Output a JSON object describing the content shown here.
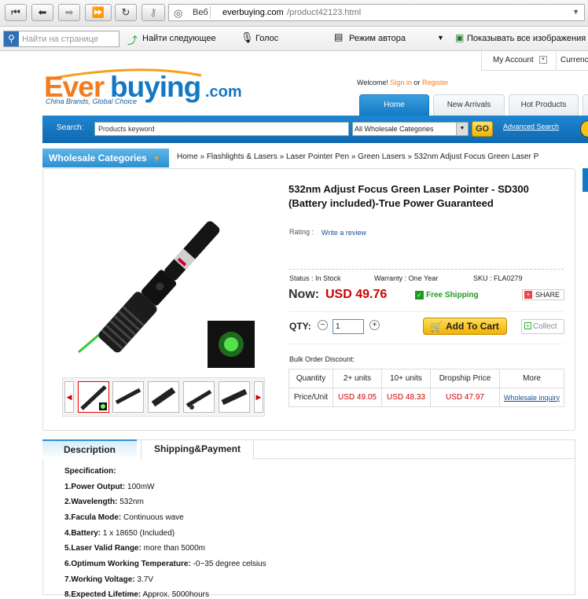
{
  "browser": {
    "address": "everbuying.com/product42123.html",
    "address_domain": "everbuying.com",
    "address_path": "/product42123.html",
    "site_chip": "Веб",
    "find_placeholder": "Найти на странице",
    "find_next": "Найти следующее",
    "voice": "Голос",
    "author_mode": "Режим автора",
    "show_images": "Показывать все изображения"
  },
  "header": {
    "my_account": "My Account",
    "currency": "Currenc",
    "logo_text": "Everbuying.com",
    "tagline": "China Brands, Global Choice",
    "welcome": "Welcome!",
    "sign_in": "Sign in",
    "or": "or",
    "register": "Register",
    "tabs": [
      "Home",
      "New Arrivals",
      "Hot Products"
    ]
  },
  "search": {
    "label": "Search:",
    "placeholder": "Products keyword",
    "category": "All Wholesale Categories",
    "go": "GO",
    "advanced": "Advanced Search"
  },
  "categories_button": "Wholesale Categories",
  "breadcrumb": [
    "Home",
    "Flashlights & Lasers",
    "Laser Pointer Pen",
    "Green Lasers",
    "532nm Adjust Focus Green Laser P"
  ],
  "product": {
    "title_line1": "532nm Adjust Focus Green Laser Pointer - SD300",
    "title_line2": "(Battery included)-True Power Guaranteed",
    "rating_label": "Rating :",
    "write_review": "Write a review",
    "status": "Status : In Stock",
    "warranty": "Warranty : One Year",
    "sku": "SKU : FLA0279",
    "now_label": "Now:",
    "price": "USD 49.76",
    "free_shipping": "Free Shipping",
    "share": "SHARE",
    "qty_label": "QTY:",
    "qty_value": "1",
    "add_to_cart": "Add To Cart",
    "collect": "Collect",
    "bulk_label": "Bulk Order Discount:",
    "bulk_headers": [
      "Quantity",
      "2+ units",
      "10+ units",
      "Dropship Price",
      "More"
    ],
    "bulk_row": [
      "Price/Unit",
      "USD 49.05",
      "USD 48.33",
      "USD 47.97",
      "Wholesale inquiry"
    ]
  },
  "tabs2": [
    "Description",
    "Shipping&Payment"
  ],
  "spec": {
    "heading": "Specification:",
    "items": [
      {
        "k": "1.Power Output:",
        "v": "100mW"
      },
      {
        "k": "2.Wavelength:",
        "v": "532nm"
      },
      {
        "k": "3.Facula Mode:",
        "v": "Continuous wave"
      },
      {
        "k": "4.Battery:",
        "v": "1 x 18650 (Included)"
      },
      {
        "k": "5.Laser Valid Range:",
        "v": "more than 5000m"
      },
      {
        "k": "6.Optimum Working Temperature:",
        "v": "-0~35 degree celsius"
      },
      {
        "k": "7.Working Voltage:",
        "v": "3.7V"
      },
      {
        "k": "8.Expected Lifetime:",
        "v": "Approx. 5000hours"
      }
    ]
  },
  "colors": {
    "brand_orange": "#f47b20",
    "brand_blue": "#1479c4",
    "price_red": "#cc0000",
    "green": "#1a9c1a"
  }
}
